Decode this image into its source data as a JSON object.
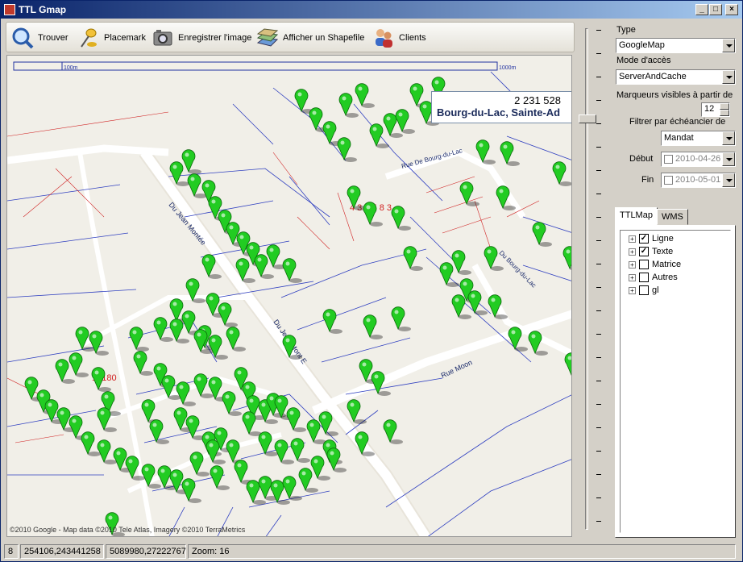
{
  "window": {
    "title": "TTL Gmap"
  },
  "toolbar": {
    "items": [
      {
        "label": "Trouver",
        "icon": "magnifier-icon"
      },
      {
        "label": "Placemark",
        "icon": "pushpin-icon"
      },
      {
        "label": "Enregistrer l'image",
        "icon": "camera-icon"
      },
      {
        "label": "Afficher un Shapefile",
        "icon": "map-layers-icon"
      },
      {
        "label": "Clients",
        "icon": "users-icon"
      }
    ]
  },
  "map": {
    "scale_left": "100m",
    "scale_right": "1000m",
    "infobox": {
      "line1": "2 231 528",
      "line2": "Bourg-du-Lac, Sainte-Ad"
    },
    "copyright": "©2010 Google - Map data ©2010 Tele Atlas, Imagery ©2010 TerraMetrics",
    "street_labels": [
      "Du Jean Montée",
      "Rue Moon",
      "Rue De Bourg-du-Lac",
      "Du Bourg-du-Lac",
      "Du Jean Mont E"
    ],
    "lot_labels": [
      "4 3 4 5 8 3",
      "16180"
    ],
    "marker_color": "#22cc22"
  },
  "panel": {
    "type_label": "Type",
    "type_value": "GoogleMap",
    "access_label": "Mode d'accès",
    "access_value": "ServerAndCache",
    "markers_label": "Marqueurs visibles à partir de",
    "markers_value": "12",
    "filter_label": "Filtrer par échéancier de",
    "filter_value": "Mandat",
    "start_label": "Début",
    "start_value": "2010-04-26",
    "end_label": "Fin",
    "end_value": "2010-05-01"
  },
  "tabs": [
    {
      "label": "TTLMap"
    },
    {
      "label": "WMS"
    }
  ],
  "tree": [
    {
      "label": "Ligne",
      "checked": true
    },
    {
      "label": "Texte",
      "checked": true
    },
    {
      "label": "Matrice",
      "checked": false
    },
    {
      "label": "Autres",
      "checked": false
    },
    {
      "label": "gl",
      "checked": false
    }
  ],
  "status": {
    "count": "8",
    "coords1": "254106,243441258",
    "coords2": "5089980,27222767",
    "zoom": "Zoom: 16"
  }
}
